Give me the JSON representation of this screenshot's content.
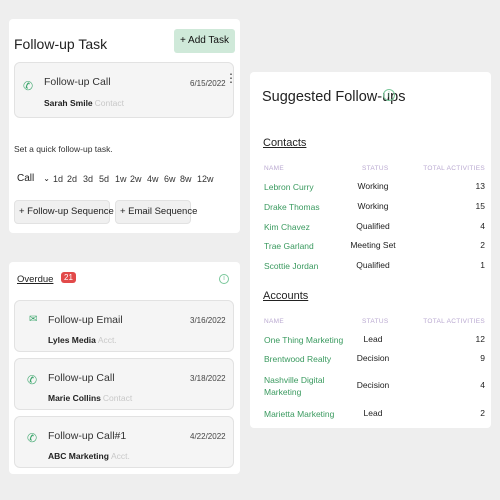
{
  "followup_task": {
    "title": "Follow-up Task",
    "add_task_label": "+ Add Task",
    "card": {
      "title": "Follow-up Call",
      "date": "6/15/2022",
      "name": "Sarah Smile",
      "type": "Contact",
      "icon": "phone-icon"
    },
    "quick_label": "Set a quick follow-up task.",
    "call_select": "Call",
    "day_options": [
      "1d",
      "2d",
      "3d",
      "5d",
      "1w",
      "2w",
      "4w",
      "6w",
      "8w",
      "12w"
    ],
    "followup_sequence_label": "+ Follow-up Sequence",
    "email_sequence_label": "+ Email Sequence"
  },
  "overdue": {
    "title": "Overdue",
    "count": "21",
    "items": [
      {
        "title": "Follow-up Email",
        "date": "3/16/2022",
        "name": "Lyles Media",
        "type": "Acct.",
        "icon": "email-icon"
      },
      {
        "title": "Follow-up Call",
        "date": "3/18/2022",
        "name": "Marie Collins",
        "type": "Contact",
        "icon": "phone-icon"
      },
      {
        "title": "Follow-up Call#1",
        "date": "4/22/2022",
        "name": "ABC Marketing",
        "type": "Acct.",
        "icon": "phone-icon"
      }
    ]
  },
  "suggested": {
    "title": "Suggested Follow-ups",
    "columns": {
      "name": "NAME",
      "status": "STATUS",
      "total": "TOTAL ACTIVITIES"
    },
    "contacts_label": "Contacts",
    "contacts": [
      {
        "name": "Lebron Curry",
        "status": "Working",
        "total": "13"
      },
      {
        "name": "Drake Thomas",
        "status": "Working",
        "total": "15"
      },
      {
        "name": "Kim Chavez",
        "status": "Qualified",
        "total": "4"
      },
      {
        "name": "Trae Garland",
        "status": "Meeting Set",
        "total": "2"
      },
      {
        "name": "Scottie Jordan",
        "status": "Qualified",
        "total": "1"
      }
    ],
    "accounts_label": "Accounts",
    "accounts": [
      {
        "name": "One Thing Marketing",
        "status": "Lead",
        "total": "12"
      },
      {
        "name": "Brentwood Realty",
        "status": "Decision",
        "total": "9"
      },
      {
        "name": "Nashville Digital Marketing",
        "status": "Decision",
        "total": "4"
      },
      {
        "name": "Marietta Marketing",
        "status": "Lead",
        "total": "2"
      }
    ]
  },
  "colors": {
    "accent_green": "#3a9a5f",
    "button_green": "#cfe9d9",
    "badge_red": "#e24a4a",
    "header_purple": "#b9a8d0"
  }
}
